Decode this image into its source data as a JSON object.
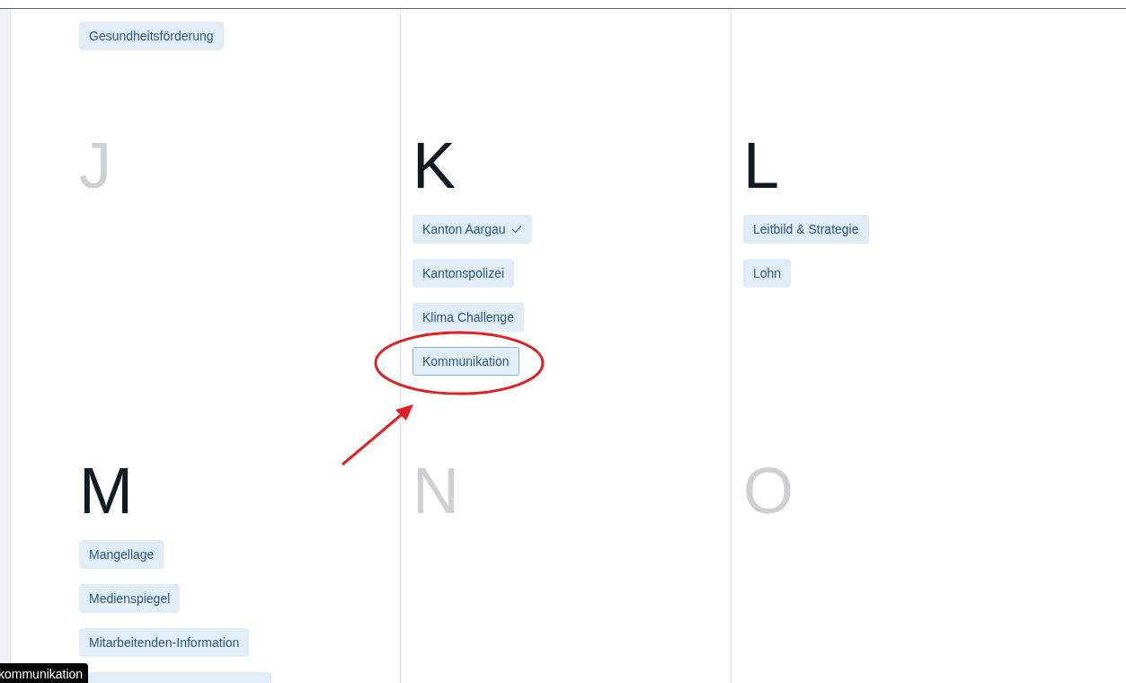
{
  "rows": [
    {
      "cells": [
        {
          "tags": [
            {
              "label": "Gesundheitsförderung",
              "checked": false,
              "hovered": false
            }
          ]
        },
        {},
        {}
      ]
    },
    {
      "cells": [
        {
          "letter": "J",
          "active": false
        },
        {
          "letter": "K",
          "active": true,
          "tags": [
            {
              "label": "Kanton Aargau",
              "checked": true,
              "hovered": false
            },
            {
              "label": "Kantonspolizei",
              "checked": false,
              "hovered": false
            },
            {
              "label": "Klima Challenge",
              "checked": false,
              "hovered": false
            },
            {
              "label": "Kommunikation",
              "checked": false,
              "hovered": true
            }
          ]
        },
        {
          "letter": "L",
          "active": true,
          "tags": [
            {
              "label": "Leitbild & Strategie",
              "checked": false,
              "hovered": false
            },
            {
              "label": "Lohn",
              "checked": false,
              "hovered": false
            }
          ]
        }
      ]
    },
    {
      "cells": [
        {
          "letter": "M",
          "active": true,
          "tags": [
            {
              "label": "Mangellage",
              "checked": false,
              "hovered": false
            },
            {
              "label": "Medienspiegel",
              "checked": false,
              "hovered": false
            },
            {
              "label": "Mitarbeitenden-Information",
              "checked": false,
              "hovered": false
            },
            {
              "kind": "partial"
            }
          ]
        },
        {
          "letter": "N",
          "active": false
        },
        {
          "letter": "O",
          "active": false
        }
      ]
    }
  ],
  "highlight_ellipse": {
    "color": "#e02020"
  },
  "pointer_arrow": {
    "color": "#e02020"
  },
  "tooltip": {
    "text": "kommunikation"
  }
}
